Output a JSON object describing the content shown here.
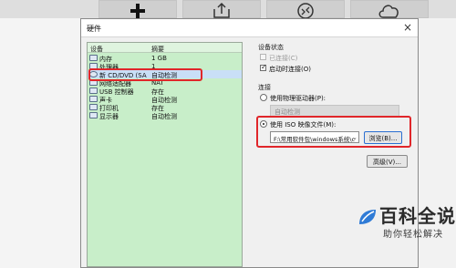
{
  "dialog": {
    "title": "硬件"
  },
  "device_list": {
    "headers": {
      "device": "设备",
      "summary": "摘要"
    },
    "rows": [
      {
        "icon": "memory-icon",
        "name": "内存",
        "summary": "1 GB",
        "selected": false
      },
      {
        "icon": "cpu-icon",
        "name": "处理器",
        "summary": "1",
        "selected": false
      },
      {
        "icon": "cd-dvd-icon",
        "name": "新 CD/DVD (SA",
        "summary": "自动检测",
        "selected": true
      },
      {
        "icon": "network-icon",
        "name": "网络适配器",
        "summary": "NAT",
        "selected": false
      },
      {
        "icon": "usb-icon",
        "name": "USB 控制器",
        "summary": "存在",
        "selected": false
      },
      {
        "icon": "sound-icon",
        "name": "声卡",
        "summary": "自动检测",
        "selected": false
      },
      {
        "icon": "printer-icon",
        "name": "打印机",
        "summary": "存在",
        "selected": false
      },
      {
        "icon": "display-icon",
        "name": "显示器",
        "summary": "自动检测",
        "selected": false
      }
    ]
  },
  "device_status": {
    "title": "设备状态",
    "connected_label": "已连接(C)",
    "connected_checked": false,
    "connected_enabled": false,
    "connect_at_power_on_label": "启动时连接(O)",
    "connect_at_power_on_checked": true
  },
  "connection": {
    "title": "连接",
    "physical_drive_label": "使用物理驱动器(P):",
    "physical_drive_value": "自动检测",
    "iso_label": "使用 ISO 映像文件(M):",
    "iso_path": "F:\\常用软件包\\windows系统\\c",
    "browse_label": "浏览(B)...",
    "selected_option": "iso"
  },
  "advanced_button_label": "高级(V)...",
  "watermark": {
    "brand": "百科全说",
    "slogan": "助你轻松解决"
  },
  "colors": {
    "highlight_red": "#e0262a",
    "list_bg": "#c8eec9",
    "accent_blue": "#2a6fd1"
  }
}
